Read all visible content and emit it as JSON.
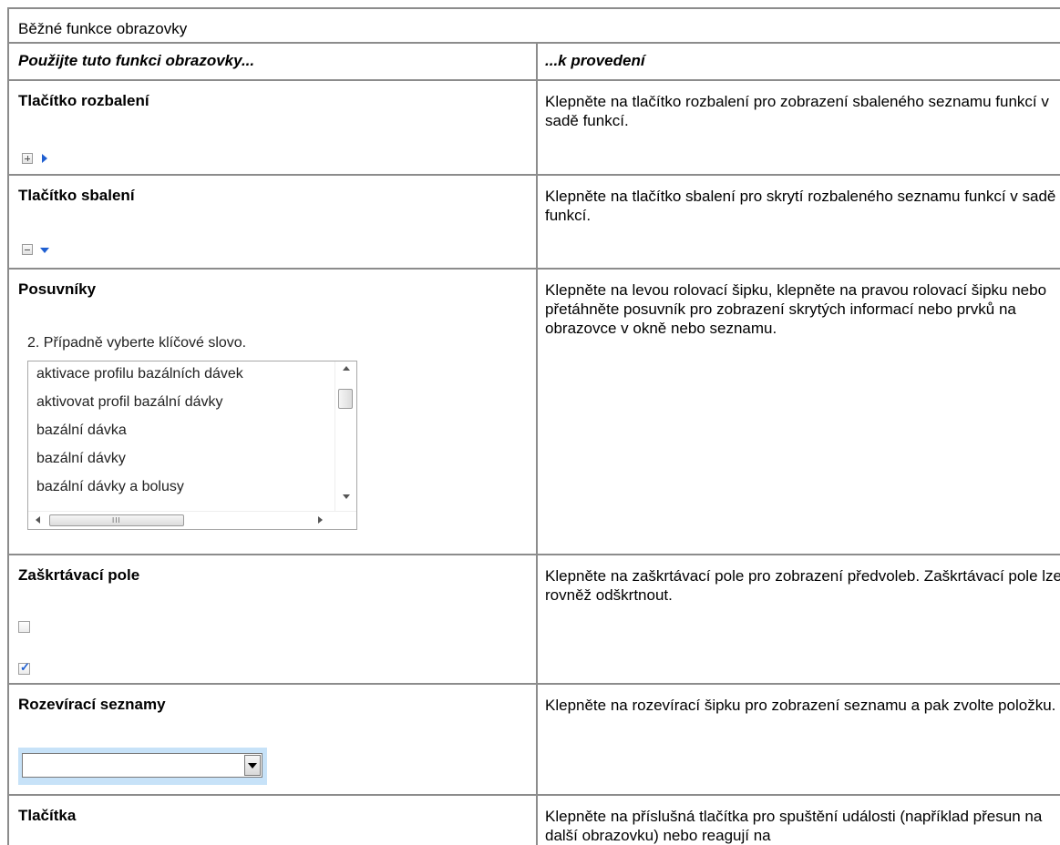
{
  "table": {
    "caption": "Běžné funkce obrazovky",
    "headers": [
      "Použijte tuto funkci obrazovky...",
      "...k provedení"
    ],
    "rows": [
      {
        "feature": "Tlačítko rozbalení",
        "description": "Klepněte na tlačítko rozbalení pro zobrazení sbaleného seznamu funkcí v sadě funkcí."
      },
      {
        "feature": "Tlačítko sbalení",
        "description": "Klepněte na tlačítko sbalení pro skrytí rozbaleného seznamu funkcí v sadě funkcí."
      },
      {
        "feature": "Posuvníky",
        "description": "Klepněte na levou rolovací šipku, klepněte na pravou rolovací šipku nebo přetáhněte posuvník pro zobrazení skrytých informací nebo prvků na obrazovce v okně nebo seznamu.",
        "sample": {
          "label": "2. Případně vyberte klíčové slovo.",
          "items": [
            "aktivace profilu bazálních dávek",
            "aktivovat profil bazální dávky",
            "bazální dávka",
            "bazální dávky",
            "bazální dávky a bolusy"
          ],
          "hscroll_grip": "III"
        }
      },
      {
        "feature": "Zaškrtávací pole",
        "description": "Klepněte na zaškrtávací pole pro zobrazení předvoleb. Zaškrtávací pole lze rovněž odškrtnout.",
        "check_glyph": "✓"
      },
      {
        "feature": "Rozevírací seznamy",
        "description": "Klepněte na rozevírací šipku pro zobrazení seznamu a pak zvolte položku."
      },
      {
        "feature": "Tlačítka",
        "description": "Klepněte na příslušná tlačítka pro spuštění události (například přesun na další obrazovku) nebo reagují na"
      }
    ]
  },
  "colors": {
    "border": "#8c8c8c",
    "icon_blue": "#1f5fd1",
    "dropdown_focus": "#c7e2f8"
  }
}
